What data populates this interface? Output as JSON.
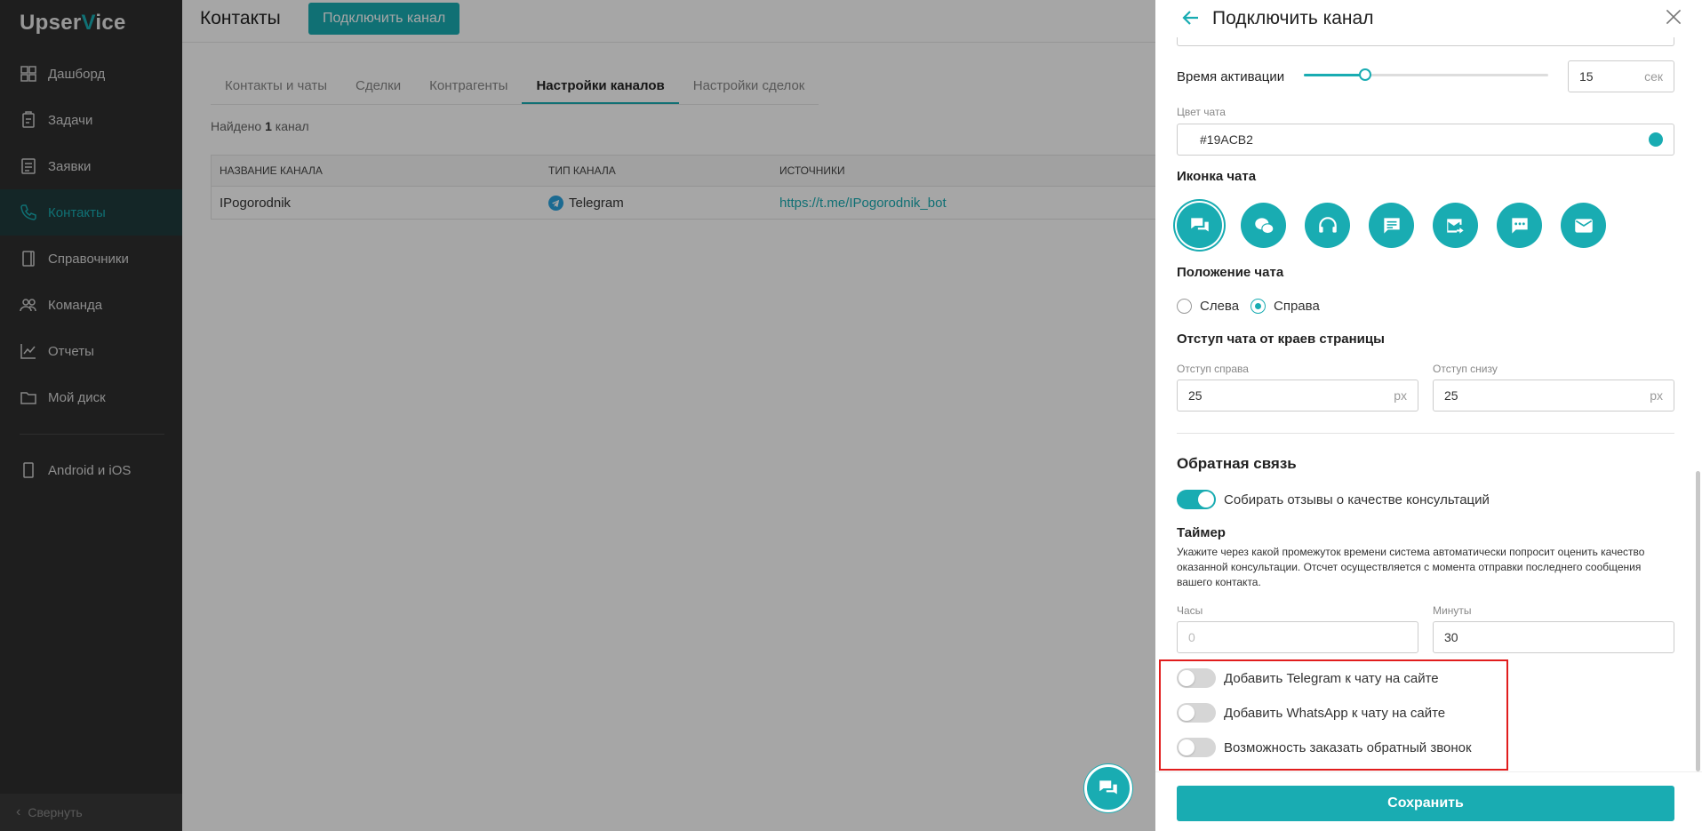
{
  "sidebar": {
    "logo_prefix": "Upser",
    "logo_accent": "V",
    "logo_suffix": "ice",
    "items": [
      {
        "label": "Дашборд",
        "icon": "grid-icon"
      },
      {
        "label": "Задачи",
        "icon": "clipboard-icon"
      },
      {
        "label": "Заявки",
        "icon": "list-icon"
      },
      {
        "label": "Контакты",
        "icon": "phone-icon"
      },
      {
        "label": "Справочники",
        "icon": "book-icon"
      },
      {
        "label": "Команда",
        "icon": "team-icon"
      },
      {
        "label": "Отчеты",
        "icon": "chart-icon"
      },
      {
        "label": "Мой диск",
        "icon": "folder-icon"
      }
    ],
    "mobile_label": "Android и iOS",
    "collapse_label": "Свернуть",
    "active_item": "Контакты"
  },
  "header": {
    "title": "Контакты",
    "connect_button": "Подключить канал"
  },
  "tabs": [
    {
      "label": "Контакты и чаты",
      "active": false
    },
    {
      "label": "Сделки",
      "active": false
    },
    {
      "label": "Контрагенты",
      "active": false
    },
    {
      "label": "Настройки каналов",
      "active": true
    },
    {
      "label": "Настройки сделок",
      "active": false
    }
  ],
  "found": {
    "prefix": "Найдено",
    "count": "1",
    "suffix": "канал"
  },
  "table": {
    "headers": [
      "НАЗВАНИЕ КАНАЛА",
      "ТИП КАНАЛА",
      "ИСТОЧНИКИ"
    ],
    "rows": [
      {
        "name": "IPogorodnik",
        "type": "Telegram",
        "source": "https://t.me/IPogorodnik_bot"
      }
    ]
  },
  "panel": {
    "title": "Подключить канал",
    "activation": {
      "label": "Время активации",
      "value": "15",
      "unit": "сек",
      "slider_fraction": 0.25
    },
    "chat_color": {
      "label": "Цвет чата",
      "value": "#19ACB2"
    },
    "chat_icon": {
      "label": "Иконка чата",
      "options": [
        "chat-bubbles-icon",
        "wechat-icon",
        "headset-icon",
        "message-icon",
        "mail-forward-icon",
        "chat-dots-icon",
        "envelope-icon"
      ],
      "selected": 0
    },
    "position": {
      "label": "Положение чата",
      "left": "Слева",
      "right": "Справа",
      "selected": "Справа"
    },
    "offset": {
      "label": "Отступ чата от краев страницы",
      "right_label": "Отступ справа",
      "right_value": "25",
      "bottom_label": "Отступ снизу",
      "bottom_value": "25",
      "unit": "px"
    },
    "feedback": {
      "title": "Обратная связь",
      "collect_label": "Собирать отзывы о качестве консультаций",
      "collect_on": true
    },
    "timer": {
      "label": "Таймер",
      "description": "Укажите через какой промежуток времени система автоматически попросит оценить качество оказанной консультации. Отсчет осуществляется с момента отправки последнего сообщения вашего контакта.",
      "hours_label": "Часы",
      "hours_placeholder": "0",
      "minutes_label": "Минуты",
      "minutes_value": "30"
    },
    "toggles": [
      {
        "label": "Добавить Telegram к чату на сайте",
        "on": false
      },
      {
        "label": "Добавить WhatsApp к чату на сайте",
        "on": false
      },
      {
        "label": "Возможность заказать обратный звонок",
        "on": false
      }
    ],
    "save_button": "Сохранить"
  },
  "colors": {
    "accent": "#19acb2",
    "sidebar": "#2e2e2e",
    "highlight": "#e11d1d"
  }
}
